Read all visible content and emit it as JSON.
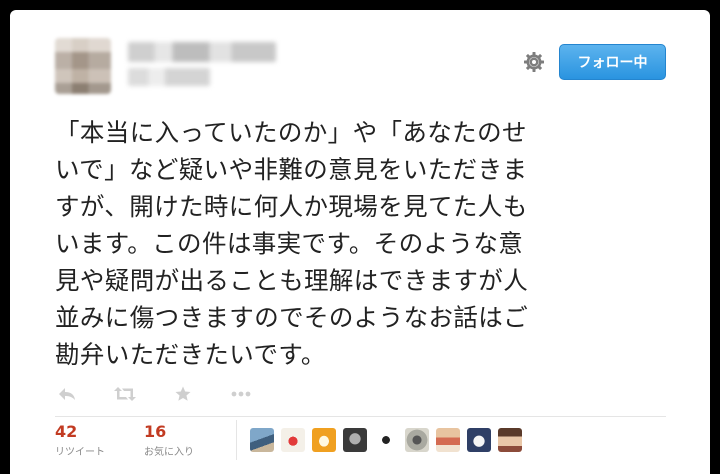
{
  "tweet": {
    "follow_button_label": "フォロー中",
    "text": "「本当に入っていたのか」や「あなたのせ\nいで」など疑いや非難の意見をいただきま\nすが、開けた時に何人か現場を見てた人も\nいます。この件は事実です。そのような意\n見や疑問が出ることも理解はできますが人\n並みに傷つきますのでそのようなお話はご\n勘弁いただきたいです。",
    "actions": [
      {
        "name": "reply-icon"
      },
      {
        "name": "retweet-icon"
      },
      {
        "name": "favorite-star-icon"
      },
      {
        "name": "more-icon"
      }
    ],
    "stats": {
      "retweets": {
        "count": "42",
        "label": "リツイート"
      },
      "favorites": {
        "count": "16",
        "label": "お気に入り"
      }
    },
    "favoriter_avatars": [
      {
        "name": "favoriter-avatar-1"
      },
      {
        "name": "favoriter-avatar-2"
      },
      {
        "name": "favoriter-avatar-3"
      },
      {
        "name": "favoriter-avatar-4"
      },
      {
        "name": "favoriter-avatar-5"
      },
      {
        "name": "favoriter-avatar-6"
      },
      {
        "name": "favoriter-avatar-7"
      },
      {
        "name": "favoriter-avatar-8"
      },
      {
        "name": "favoriter-avatar-9"
      }
    ]
  },
  "colors": {
    "follow_button": "#2a94e0",
    "stat_number": "#c23b22",
    "text": "#222222"
  }
}
